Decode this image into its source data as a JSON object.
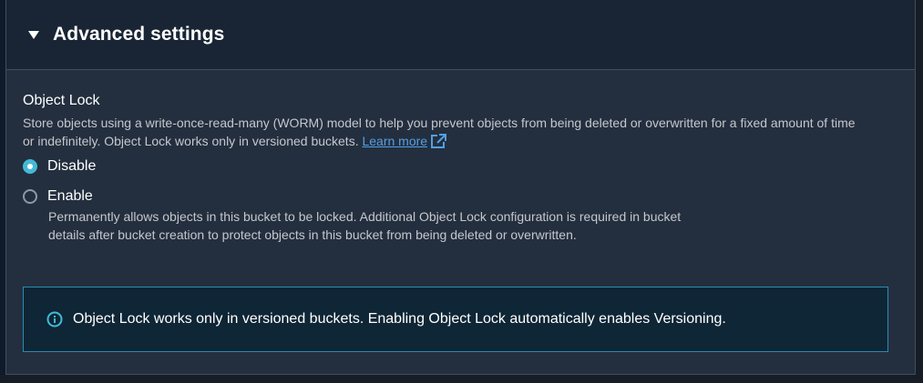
{
  "colors": {
    "panel_bg": "#232f3e",
    "header_bg": "#192534",
    "accent": "#44b9d6",
    "link": "#539fe5",
    "alert_border": "#2b8bb0",
    "alert_bg": "#0e2636"
  },
  "header": {
    "title": "Advanced settings",
    "toggle_icon": "caret-down-icon",
    "expanded": true
  },
  "object_lock": {
    "label": "Object Lock",
    "description": "Store objects using a write-once-read-many (WORM) model to help you prevent objects from being deleted or overwritten for a fixed amount of time or indefinitely. Object Lock works only in versioned buckets.",
    "learn_more": "Learn more",
    "learn_more_icon": "external-link-icon",
    "options": [
      {
        "label": "Disable",
        "checked": true
      },
      {
        "label": "Enable",
        "checked": false,
        "description": "Permanently allows objects in this bucket to be locked. Additional Object Lock configuration is required in bucket details after bucket creation to protect objects in this bucket from being deleted or overwritten."
      }
    ]
  },
  "alert": {
    "icon": "info-icon",
    "text": "Object Lock works only in versioned buckets. Enabling Object Lock automatically enables Versioning."
  }
}
